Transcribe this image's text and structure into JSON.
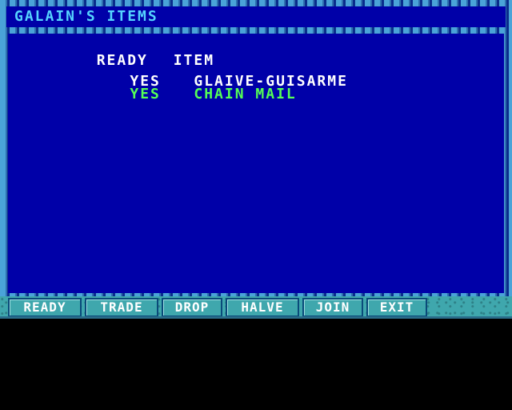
{
  "window": {
    "title": "GALAIN'S ITEMS"
  },
  "table": {
    "headers": {
      "ready": "READY",
      "item": "ITEM"
    },
    "rows": [
      {
        "ready": "YES",
        "item": "GLAIVE-GUISARME",
        "selected": true
      },
      {
        "ready": "YES",
        "item": "CHAIN MAIL",
        "selected": false
      }
    ]
  },
  "menu": {
    "ready": "READY",
    "trade": "TRADE",
    "drop": "DROP",
    "halve": "HALVE",
    "join": "JOIN",
    "exit": "EXIT"
  },
  "colors": {
    "panel": "#0000a8",
    "title_text": "#55d4ff",
    "selected_text": "#ffffff",
    "item_text": "#55ff55",
    "menu_bg": "#3fa7ad"
  },
  "icons": {
    "cursor": "sword-cursor-icon"
  }
}
